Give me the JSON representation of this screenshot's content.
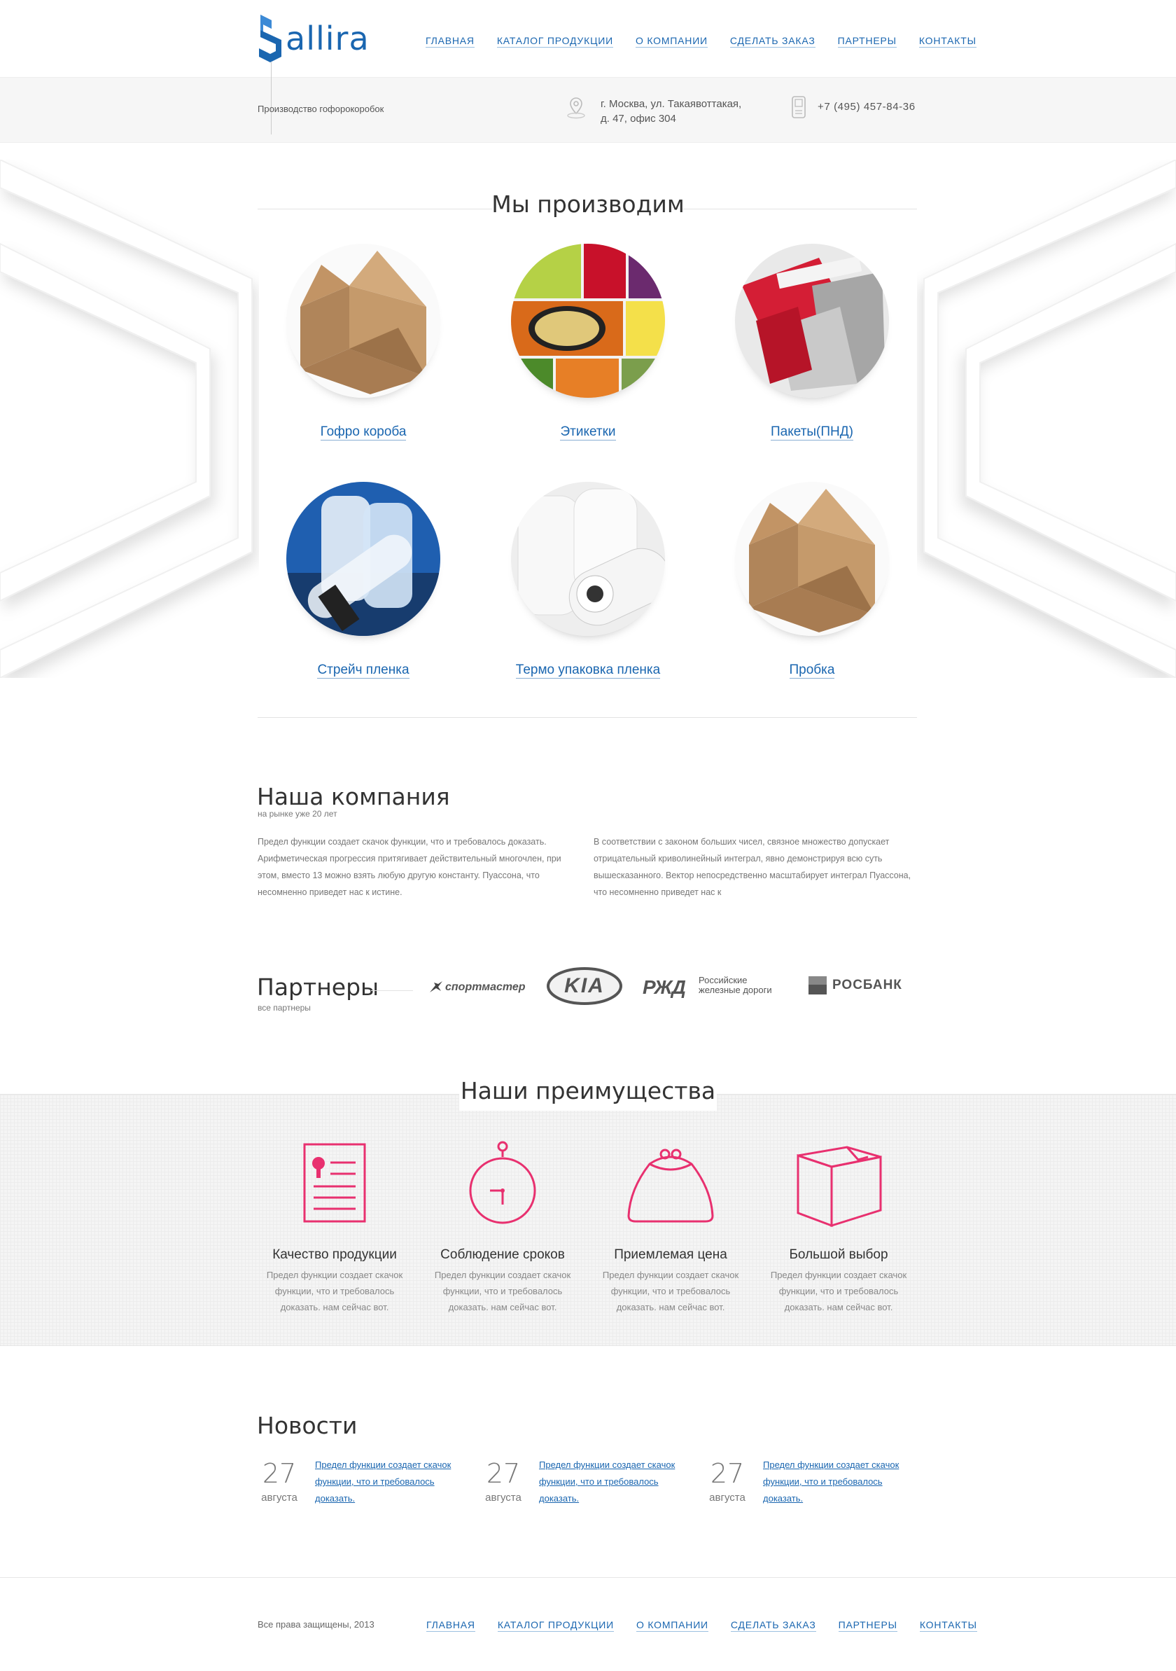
{
  "header": {
    "brand": "allira",
    "tagline": "Производство гофорокоробок",
    "address_line1": "г. Москва, ул. Такаявоттакая,",
    "address_line2": "д. 47, офис 304",
    "phone": "+7 (495) 457-84-36",
    "nav": [
      "ГЛАВНАЯ",
      "КАТАЛОГ ПРОДУКЦИИ",
      "О КОМПАНИИ",
      "СДЕЛАТЬ ЗАКАЗ",
      "ПАРТНЕРЫ",
      "КОНТАКТЫ"
    ]
  },
  "products": {
    "title": "Мы производим",
    "items": [
      {
        "label": "Гофро короба"
      },
      {
        "label": "Этикетки"
      },
      {
        "label": "Пакеты(ПНД)"
      },
      {
        "label": "Стрейч пленка"
      },
      {
        "label": "Термо упаковка пленка"
      },
      {
        "label": "Пробка"
      }
    ]
  },
  "company": {
    "title": "Наша компания",
    "subtitle": "на рынке уже 20 лет",
    "para1": "Предел функции создает скачок функции, что и требовалось доказать. Арифметическая прогрессия притягивает действительный многочлен, при этом, вместо 13 можно взять любую другую константу. Пуассона, что несомненно приведет нас к истине.",
    "para2": "В соответствии с законом больших чисел, связное множество допускает отрицательный криволинейный интеграл, явно демонстрируя всю суть вышесказанного. Вектор непосредственно масштабирует интеграл Пуассона, что несомненно приведет нас к"
  },
  "partners": {
    "title": "Партнеры",
    "link": "все партнеры",
    "logos": {
      "sportmaster": "спортмастер",
      "kia": "KIA",
      "rzd_mark": "РЖД",
      "rzd_line1": "Российские",
      "rzd_line2": "железные дороги",
      "rosbank": "РОСБАНК"
    }
  },
  "advantages": {
    "title": "Наши преимущества",
    "accent_color": "#e8306f",
    "items": [
      {
        "icon": "certificate-icon",
        "title": "Качество продукции",
        "text": "Предел функции создает скачок функции, что и требовалось доказать. нам сейчас вот."
      },
      {
        "icon": "stopwatch-icon",
        "title": "Соблюдение сроков",
        "text": "Предел функции создает скачок функции, что и требовалось доказать. нам сейчас вот."
      },
      {
        "icon": "purse-icon",
        "title": "Приемлемая цена",
        "text": "Предел функции создает скачок функции, что и требовалось доказать. нам сейчас вот."
      },
      {
        "icon": "box-icon",
        "title": "Большой выбор",
        "text": "Предел функции создает скачок функции, что и требовалось доказать. нам сейчас вот."
      }
    ]
  },
  "news": {
    "title": "Новости",
    "items": [
      {
        "day": "27",
        "month": "августа",
        "text": "Предел функции создает скачок функции, что и требовалось доказать."
      },
      {
        "day": "27",
        "month": "августа",
        "text": "Предел функции создает скачок функции, что и требовалось доказать."
      },
      {
        "day": "27",
        "month": "августа",
        "text": "Предел функции создает скачок функции, что и требовалось доказать."
      }
    ]
  },
  "footer": {
    "copyright": "Все права защищены, 2013",
    "nav": [
      "ГЛАВНАЯ",
      "КАТАЛОГ ПРОДУКЦИИ",
      "О КОМПАНИИ",
      "СДЕЛАТЬ ЗАКАЗ",
      "ПАРТНЕРЫ",
      "КОНТАКТЫ"
    ]
  },
  "colors": {
    "brand": "#1a66b0",
    "accent": "#e8306f"
  }
}
